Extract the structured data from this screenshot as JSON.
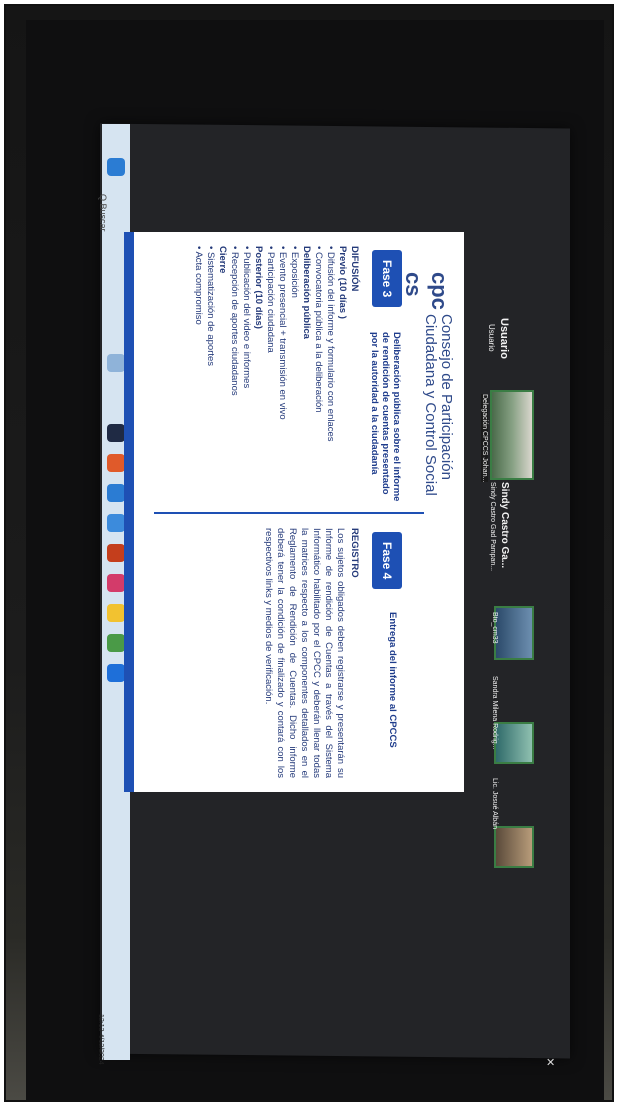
{
  "zoom": {
    "main_participant": {
      "name": "Usuario",
      "sub": "Usuario"
    },
    "participants": [
      {
        "name": "Sindy Castro Ga...",
        "label": "Delegación CPCCS Johan..."
      },
      {
        "name": "Sindy Castro Gad Pampan...",
        "label": "Sindy Castro Gad Pampan..."
      },
      {
        "name": "Bto_cm33",
        "label": "Bto_cm33"
      },
      {
        "name": "Sandra Milena Rodrig...",
        "label": "Sandra Milena Rodrig..."
      },
      {
        "name": "Lic. Josué Albán",
        "label": "Lic. Josué Albán"
      }
    ]
  },
  "taskbar": {
    "search": "Q Buscar",
    "clock_time": "12:13",
    "clock_date": "4/12/2024"
  },
  "slide": {
    "org_line1": "Consejo de Participación",
    "org_line2": "Ciudadana y Control Social",
    "logo_text": "cpc cs",
    "fase3": {
      "label": "Fase 3",
      "title": "Deliberación pública sobre el informe de rendición de cuentas presentado por la autoridad a la ciudadanía",
      "items": [
        {
          "t": "DIFUSIÓN",
          "bold": true
        },
        {
          "t": "Previo (10 días )",
          "bold": true
        },
        {
          "t": "• Difusión del informe y formulario con enlaces",
          "bold": false
        },
        {
          "t": "• Convocatoria pública a la deliberación",
          "bold": false
        },
        {
          "t": "Deliberación pública",
          "bold": true
        },
        {
          "t": "• Exposición",
          "bold": false
        },
        {
          "t": "• Evento presencial + transmisión en vivo",
          "bold": false
        },
        {
          "t": "• Participación ciudadana",
          "bold": false
        },
        {
          "t": "Posterior (10 días)",
          "bold": true
        },
        {
          "t": "• Publicación del video e informes",
          "bold": false
        },
        {
          "t": "• Recepción de aportes ciudadanos",
          "bold": false
        },
        {
          "t": "Cierre",
          "bold": true
        },
        {
          "t": "• Sistematización de aportes",
          "bold": false
        },
        {
          "t": "• Acta compromiso",
          "bold": false
        }
      ]
    },
    "fase4": {
      "label": "Fase 4",
      "title": "Entrega del informe al CPCCS",
      "heading": "REGISTRO",
      "body": "Los sujetos obligados deben registrarse y presentarán su Informe de rendición de Cuentas a través del Sistema Informático habilitado por el CPCC y deberán llenar todas la matrices respecto a los componentes detallados en el Reglamento de Rendición de Cuentas. Dicho informe deberá tener la condición de finalizado y contará con los respectivos links y medios de verificación."
    }
  }
}
